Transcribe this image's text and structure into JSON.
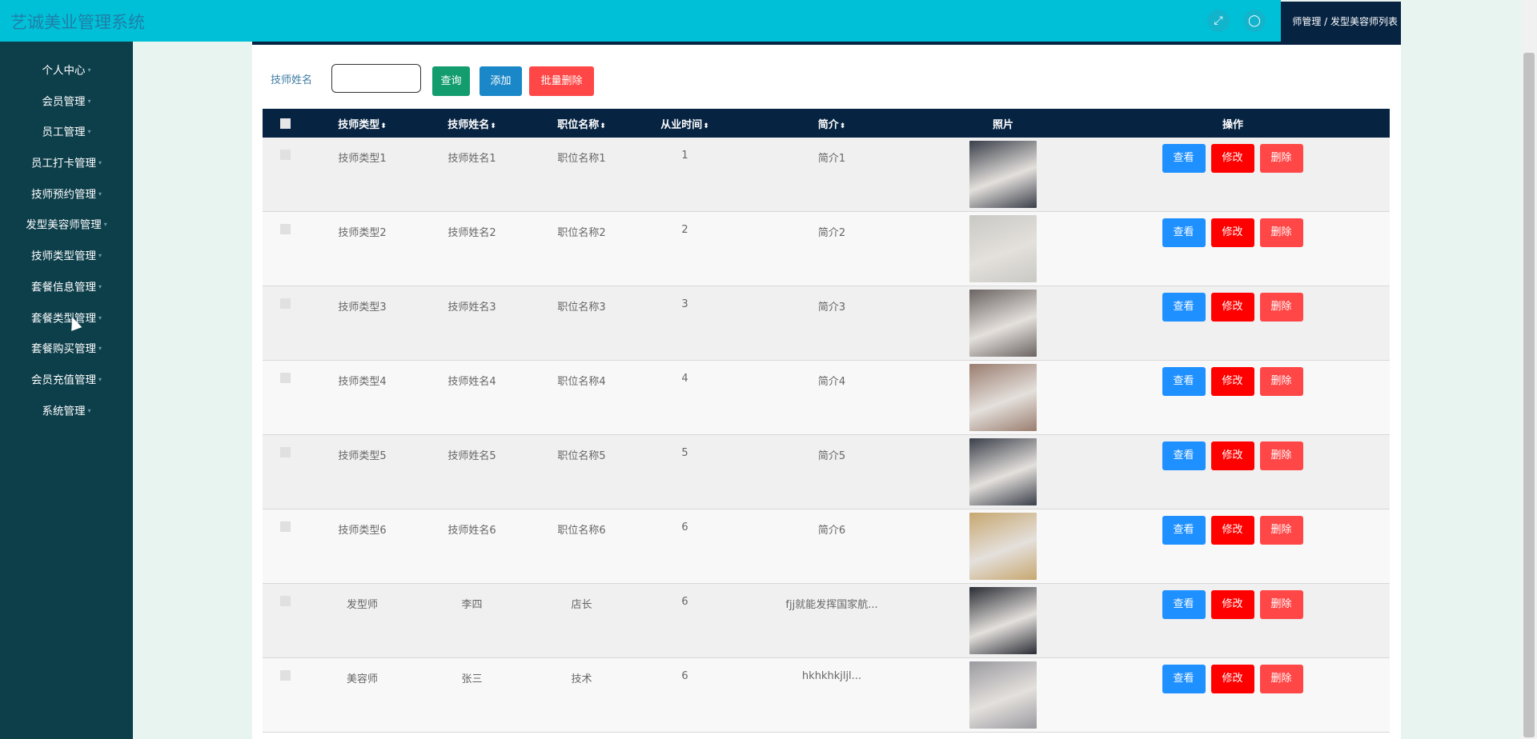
{
  "app": {
    "title": "艺诚美业管理系统"
  },
  "header": {
    "breadcrumb": "师管理 / 发型美容师列表",
    "fullscreen_icon": "expand-icon",
    "user_icon": "user-icon"
  },
  "sidebar": {
    "items": [
      {
        "label": "个人中心"
      },
      {
        "label": "会员管理"
      },
      {
        "label": "员工管理"
      },
      {
        "label": "员工打卡管理"
      },
      {
        "label": "技师预约管理"
      },
      {
        "label": "发型美容师管理"
      },
      {
        "label": "技师类型管理"
      },
      {
        "label": "套餐信息管理"
      },
      {
        "label": "套餐类型管理"
      },
      {
        "label": "套餐购买管理"
      },
      {
        "label": "会员充值管理"
      },
      {
        "label": "系统管理"
      }
    ]
  },
  "search": {
    "label": "技师姓名",
    "value": "",
    "buttons": {
      "query": "查询",
      "add": "添加",
      "batch_delete": "批量删除"
    }
  },
  "table": {
    "columns": [
      "技师类型",
      "技师姓名",
      "职位名称",
      "从业时间",
      "简介",
      "照片",
      "操作"
    ],
    "sortable": [
      true,
      true,
      true,
      true,
      true,
      false,
      false
    ],
    "sort_icon": "⬍",
    "actions": {
      "view": "查看",
      "edit": "修改",
      "delete": "删除"
    },
    "rows": [
      {
        "type": "技师类型1",
        "name": "技师姓名1",
        "position": "职位名称1",
        "years": "1",
        "intro": "简介1",
        "photo_tone": "#3a3f4a"
      },
      {
        "type": "技师类型2",
        "name": "技师姓名2",
        "position": "职位名称2",
        "years": "2",
        "intro": "简介2",
        "photo_tone": "#c9c9c4"
      },
      {
        "type": "技师类型3",
        "name": "技师姓名3",
        "position": "职位名称3",
        "years": "3",
        "intro": "简介3",
        "photo_tone": "#6b6462"
      },
      {
        "type": "技师类型4",
        "name": "技师姓名4",
        "position": "职位名称4",
        "years": "4",
        "intro": "简介4",
        "photo_tone": "#9a7d6f"
      },
      {
        "type": "技师类型5",
        "name": "技师姓名5",
        "position": "职位名称5",
        "years": "5",
        "intro": "简介5",
        "photo_tone": "#3a3f4a"
      },
      {
        "type": "技师类型6",
        "name": "技师姓名6",
        "position": "职位名称6",
        "years": "6",
        "intro": "简介6",
        "photo_tone": "#c7a770"
      },
      {
        "type": "发型师",
        "name": "李四",
        "position": "店长",
        "years": "6",
        "intro": "fjj就能发挥国家航...",
        "photo_tone": "#2a2d35"
      },
      {
        "type": "美容师",
        "name": "张三",
        "position": "技术",
        "years": "6",
        "intro": "hkhkhkjljl...",
        "photo_tone": "#9a9aa0"
      }
    ]
  },
  "colors": {
    "topbar": "#00c0d8",
    "sidebar": "#0d3f4b",
    "table_header": "#062342",
    "query_btn": "#139d6e",
    "add_btn": "#1a88c8",
    "batch_delete_btn": "#ff4747"
  }
}
